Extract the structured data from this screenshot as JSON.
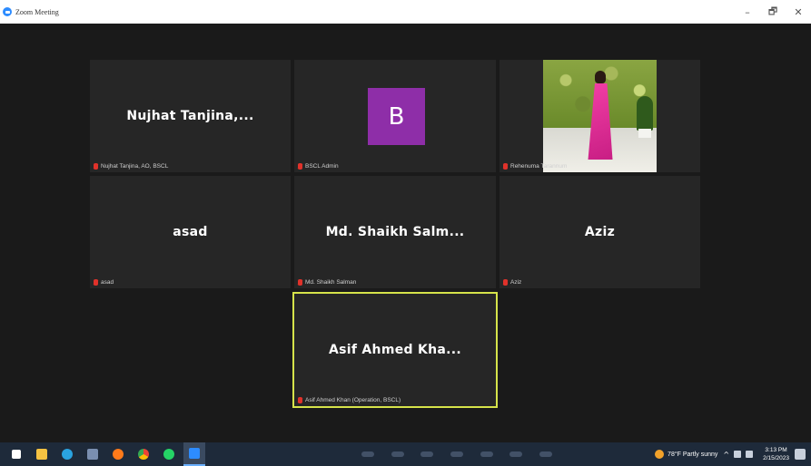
{
  "window": {
    "title": "Zoom Meeting",
    "minimize": "–",
    "restore": "🗗",
    "close": "✕"
  },
  "tiles": [
    {
      "display_name": "Nujhat  Tanjina,...",
      "label": "Nujhat Tanjina, AO, BSCL"
    },
    {
      "avatar_letter": "B",
      "label": "BSCL Admin"
    },
    {
      "label": "Rehenuma Tarannum"
    },
    {
      "display_name": "asad",
      "label": "asad"
    },
    {
      "display_name": "Md.  Shaikh  Salm...",
      "label": "Md. Shaikh Salman"
    },
    {
      "display_name": "Aziz",
      "label": "Aziz"
    },
    {
      "display_name": "Asif  Ahmed  Kha...",
      "label": "Asif Ahmed Khan (Operation, BSCL)"
    }
  ],
  "taskbar": {
    "icons": [
      "windows-start-icon",
      "file-explorer-icon",
      "telegram-icon",
      "folder-icon",
      "firefox-icon",
      "chrome-icon",
      "whatsapp-icon",
      "zoom-icon"
    ],
    "icon_colors": [
      "#ffffff",
      "#f5c242",
      "#2aa3e0",
      "#7a8fb0",
      "#ff7a1a",
      "#34a853",
      "#25d366",
      "#2d8cff"
    ],
    "weather": "78°F  Partly sunny",
    "chevron": "^",
    "time": "3:13 PM",
    "date": "2/15/2023"
  },
  "colors": {
    "active_speaker_border": "#d6e34a",
    "avatar_bg": "#8e2ea8",
    "muted_mic": "#e0322b"
  }
}
